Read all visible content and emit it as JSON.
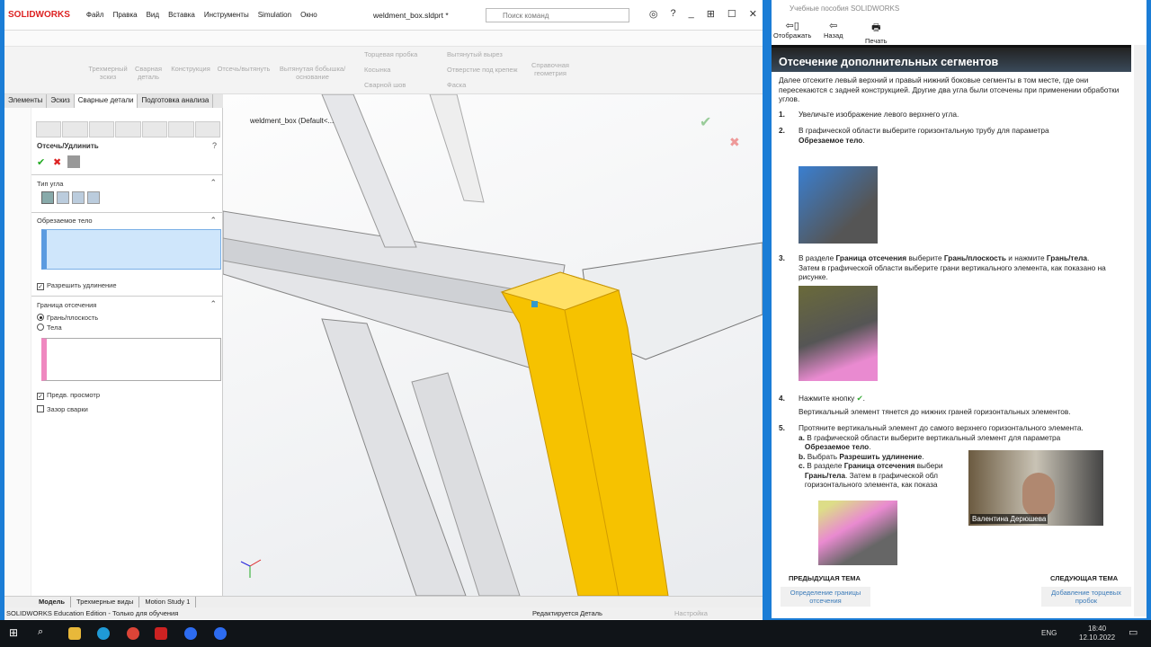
{
  "app": {
    "logo": "SOLIDWORKS",
    "menu": [
      "Файл",
      "Правка",
      "Вид",
      "Вставка",
      "Инструменты",
      "Simulation",
      "Окно"
    ],
    "doc_title": "weldment_box.sldprt *",
    "search_placeholder": "Поиск команд"
  },
  "command_manager": {
    "items": [
      "Трехмерный эскиз",
      "Сварная деталь",
      "Конструкция",
      "Отсечь/вытянуть",
      "Вытянутая бобышка/основание",
      "Торцевая пробка",
      "Косынка",
      "Сварной шов",
      "Вытянутый вырез",
      "Отверстие под крепеж",
      "Фаска",
      "Справочная геометрия"
    ]
  },
  "tabs": [
    "Элементы",
    "Эскиз",
    "Сварные детали",
    "Подготовка анализа"
  ],
  "tree": {
    "root": "weldment_box  (Default<..."
  },
  "property_manager": {
    "title": "Отсечь/Удлинить",
    "corner_type_label": "Тип угла",
    "trim_body_label": "Обрезаемое тело",
    "allow_extension": "Разрешить удлинение",
    "trim_boundary_label": "Граница отсечения",
    "face_plane": "Грань/плоскость",
    "bodies": "Тела",
    "preview": "Предв. просмотр",
    "weld_gap": "Зазор сварки"
  },
  "bottom_tabs": [
    "Модель",
    "Трехмерные виды",
    "Motion Study 1"
  ],
  "status": {
    "left": "SOLIDWORKS Education Edition - Только для обучения",
    "middle": "Редактируется Деталь",
    "settings": "Настройка"
  },
  "help": {
    "window_title": "Учебные пособия SOLIDWORKS",
    "toolbar": [
      "Отображать",
      "Назад",
      "Печать"
    ],
    "heading": "Отсечение дополнительных сегментов",
    "intro": "Далее отсеките левый верхний и правый нижний боковые сегменты в том месте, где они пересекаются с задней конструкцией. Другие два угла были отсечены при применении обработки углов.",
    "step1": "Увеличьте изображение левого верхнего угла.",
    "step2a": "В графической области выберите горизонтальную трубу для параметра",
    "step2b": "Обрезаемое тело",
    "step3a": "В разделе",
    "step3b": "Граница отсечения",
    "step3c": "выберите",
    "step3d": "Грань/плоскость",
    "step3e": "и нажмите",
    "step3f": "Грань/тела",
    "step3g": "Затем в графической области выберите грани вертикального элемента, как показано на рисунке.",
    "step4": "Нажмите кнопку",
    "step4note": "Вертикальный элемент тянется до нижних граней горизонтальных элементов.",
    "step5": "Протяните вертикальный элемент до самого верхнего горизонтального элемента.",
    "step5a1": "В графической области выберите вертикальный элемент для параметра",
    "step5a2": "Обрезаемое тело",
    "step5b1": "Выбрать",
    "step5b2": "Разрешить удлинение",
    "step5c1": "В разделе",
    "step5c2": "Граница отсечения",
    "step5c3": "выбери",
    "step5c4": "Грань/тела",
    "step5c5": "Затем в графической обл",
    "step5c6": "горизонтального элемента, как показа",
    "prev_label": "Предыдущая тема",
    "prev_link": "Определение границы отсечения",
    "next_label": "Следующая тема",
    "next_link": "Добавление торцевых пробок"
  },
  "video": {
    "name": "Валентина Дерюшева"
  },
  "taskbar": {
    "lang": "ENG",
    "time": "18:40",
    "date": "12.10.2022"
  }
}
